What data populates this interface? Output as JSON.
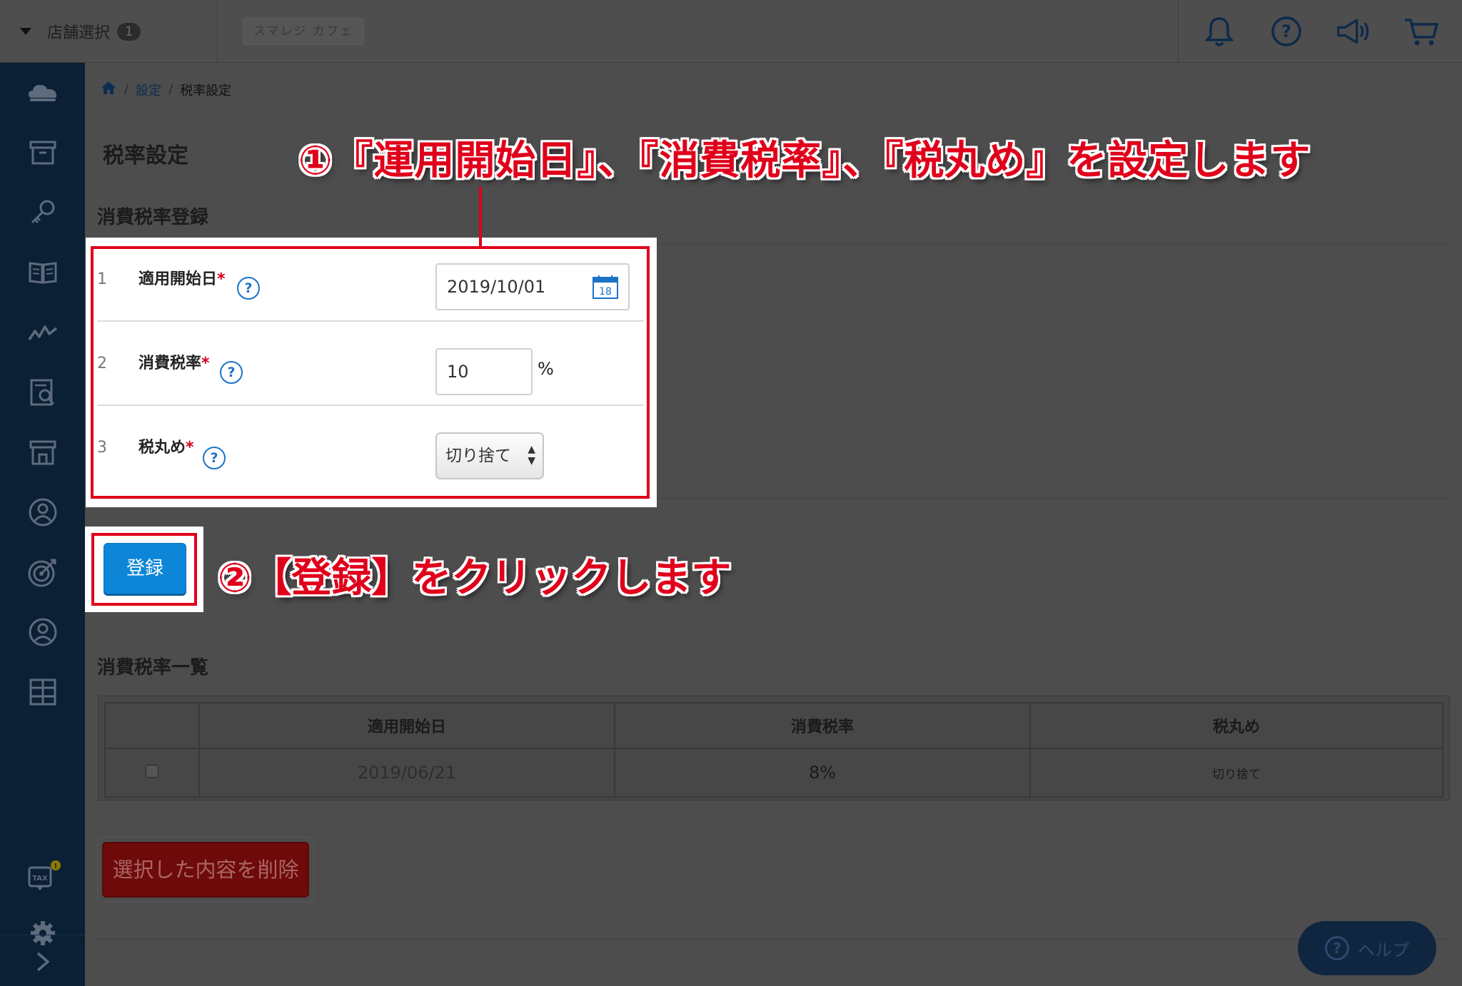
{
  "topbar": {
    "store_select_label": "店舗選択",
    "store_count": "1",
    "store_name": "スマレジ カフェ",
    "icons": [
      "bell-icon",
      "help-circle-icon",
      "megaphone-icon",
      "cart-icon"
    ]
  },
  "sidebar": {
    "icons": [
      "cloud-icon",
      "box-icon",
      "key-icon",
      "book-icon",
      "chart-line-icon",
      "report-icon",
      "store-icon",
      "user-badge-icon",
      "target-icon",
      "member-icon",
      "grid-icon"
    ],
    "bottom_icons": [
      "tax-icon",
      "settings-icon",
      "expand-icon"
    ],
    "tax_icon_label": "TAX"
  },
  "breadcrumb": {
    "home_icon": "home-icon",
    "items": [
      "設定",
      "税率設定"
    ],
    "separator": "/"
  },
  "page_title": "税率設定",
  "registration": {
    "heading": "消費税率登録",
    "rows": [
      {
        "num": "1",
        "label": "適用開始日",
        "value": "2019/10/01"
      },
      {
        "num": "2",
        "label": "消費税率",
        "value": "10",
        "unit": "%"
      },
      {
        "num": "3",
        "label": "税丸め",
        "value": "切り捨て"
      }
    ],
    "required_mark": "*",
    "help_mark": "?",
    "calendar_day": "18",
    "register_button": "登録"
  },
  "annotations": {
    "step1": "①『運用開始日』、『消費税率』、『税丸め』を設定します",
    "step2": "②【登録】をクリックします"
  },
  "list": {
    "heading": "消費税率一覧",
    "columns": [
      "適用開始日",
      "消費税率",
      "税丸め"
    ],
    "rows": [
      {
        "date": "2019/06/21",
        "rate": "8%",
        "rounding": "切り捨て"
      }
    ],
    "delete_button": "選択した内容を削除"
  },
  "help_button": "ヘルプ",
  "colors": {
    "annotation_red": "#e0001b",
    "primary_blue": "#0e86d8",
    "sidebar_bg": "#0b1f35",
    "overlay_gray": "#4d4d4d"
  }
}
